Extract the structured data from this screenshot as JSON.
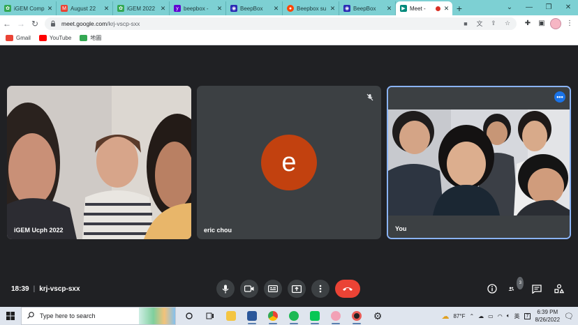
{
  "browser": {
    "tabs": [
      {
        "title": "iGEM Comp",
        "favicon_color": "#34a853",
        "favicon": "gear-icon"
      },
      {
        "title": "August 22",
        "favicon_color": "#ea4335",
        "favicon": "gmail-icon"
      },
      {
        "title": "iGEM 2022",
        "favicon_color": "#34a853",
        "favicon": "gear-icon"
      },
      {
        "title": "beepbox -",
        "favicon_color": "#6001d2",
        "favicon": "yahoo-icon"
      },
      {
        "title": "BeepBox",
        "favicon_color": "#2b2bb5",
        "favicon": "beepbox-icon"
      },
      {
        "title": "Beepbox su",
        "favicon_color": "#ff4500",
        "favicon": "reddit-icon"
      },
      {
        "title": "BeepBox",
        "favicon_color": "#2b2bb5",
        "favicon": "beepbox-icon"
      },
      {
        "title": "Meet -",
        "favicon_color": "#00897b",
        "favicon": "meet-icon",
        "active": true
      }
    ],
    "url_host": "meet.google.com",
    "url_path": "/krj-vscp-sxx",
    "bookmarks": [
      {
        "label": "Gmail",
        "color": "#ea4335"
      },
      {
        "label": "YouTube",
        "color": "#ff0000"
      },
      {
        "label": "地圖",
        "color": "#34a853"
      }
    ]
  },
  "meet": {
    "tiles": [
      {
        "name": "iGEM Ucph 2022"
      },
      {
        "name": "eric chou",
        "initial": "e",
        "avatar_color": "#c2410f"
      },
      {
        "name": "You"
      }
    ],
    "time": "18:39",
    "meeting_code": "krj-vscp-sxx",
    "participant_count": "3",
    "accent": "#8ab4f8",
    "end_call_color": "#ea4335"
  },
  "taskbar": {
    "search_placeholder": "Type here to search",
    "weather": "87°F",
    "ime": "英",
    "time": "6:39 PM",
    "date": "8/26/2022",
    "notification_count": "7"
  }
}
